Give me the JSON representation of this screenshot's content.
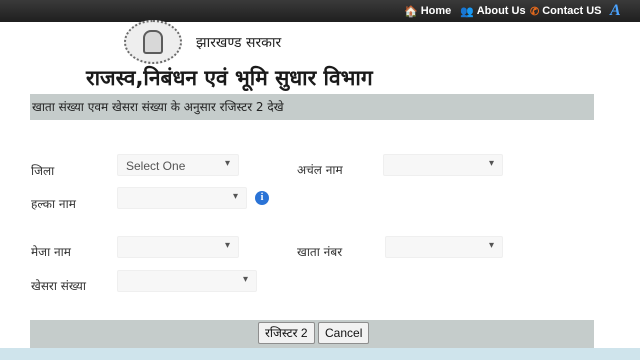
{
  "nav": {
    "home": "Home",
    "about": "About Us",
    "contact": "Contact US",
    "accessibility": "A"
  },
  "header": {
    "gov_name": "झारखण्ड सरकार",
    "dept_name": "राजस्व,निबंधन एवं भूमि सुधार  विभाग"
  },
  "form": {
    "heading": "खाता संख्या एवम खेसरा संख्या के अनुसार रजिस्टर 2 देखे",
    "district_label": "जिला",
    "district_value": "Select One",
    "circle_label": "अचंल नाम",
    "circle_value": "",
    "halka_label": "हल्का नाम",
    "halka_value": "",
    "mauza_label": "मेजा नाम",
    "mauza_value": "",
    "khata_label": "खाता नंबर",
    "khata_value": "",
    "khesra_label": "खेसरा संख्या",
    "khesra_value": ""
  },
  "actions": {
    "register_label": "रजिस्टर 2",
    "cancel_label": "Cancel"
  },
  "colors": {
    "topbar": "#2b2b2b",
    "band": "#c5cccb",
    "info_icon": "#2a73d6"
  }
}
